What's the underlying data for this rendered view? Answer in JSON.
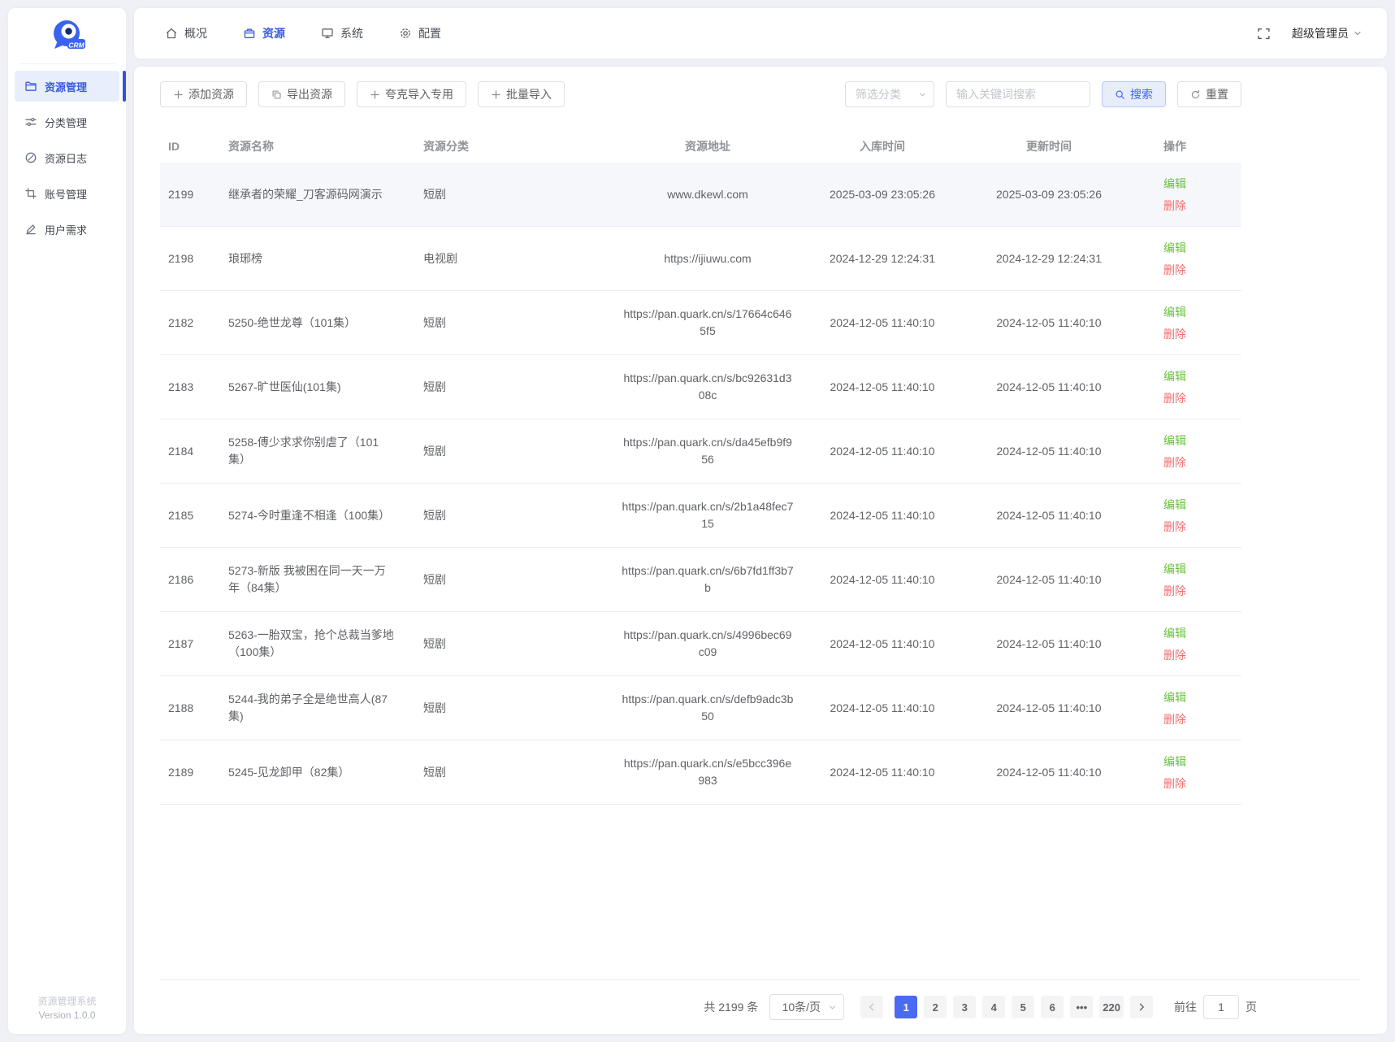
{
  "app": {
    "system_name": "资源管理系统",
    "version": "Version 1.0.0"
  },
  "topnav": {
    "items": [
      {
        "label": "概况",
        "icon": "home-icon",
        "active": false
      },
      {
        "label": "资源",
        "icon": "box-icon",
        "active": true
      },
      {
        "label": "系统",
        "icon": "monitor-icon",
        "active": false
      },
      {
        "label": "配置",
        "icon": "gear-icon",
        "active": false
      }
    ],
    "user": "超级管理员"
  },
  "sidebar": {
    "items": [
      {
        "label": "资源管理",
        "icon": "folder-icon",
        "active": true
      },
      {
        "label": "分类管理",
        "icon": "sliders-icon",
        "active": false
      },
      {
        "label": "资源日志",
        "icon": "compass-icon",
        "active": false
      },
      {
        "label": "账号管理",
        "icon": "crop-icon",
        "active": false
      },
      {
        "label": "用户需求",
        "icon": "pen-icon",
        "active": false
      }
    ]
  },
  "toolbar": {
    "add_label": "添加资源",
    "export_label": "导出资源",
    "quark_label": "夸克导入专用",
    "batch_label": "批量导入",
    "filter_placeholder": "筛选分类",
    "search_placeholder": "输入关键词搜索",
    "search_label": "搜索",
    "reset_label": "重置"
  },
  "table": {
    "columns": [
      "ID",
      "资源名称",
      "资源分类",
      "资源地址",
      "入库时间",
      "更新时间",
      "操作"
    ],
    "actions": {
      "edit": "编辑",
      "delete": "删除"
    },
    "rows": [
      {
        "id": "2199",
        "name": "继承者的荣耀_刀客源码网演示",
        "category": "短剧",
        "url": "www.dkewl.com",
        "created": "2025-03-09 23:05:26",
        "updated": "2025-03-09 23:05:26",
        "highlight": true
      },
      {
        "id": "2198",
        "name": "琅琊榜",
        "category": "电视剧",
        "url": "https://ijiuwu.com",
        "created": "2024-12-29 12:24:31",
        "updated": "2024-12-29 12:24:31",
        "highlight": false
      },
      {
        "id": "2182",
        "name": "5250-绝世龙尊（101集）",
        "category": "短剧",
        "url": "https://pan.quark.cn/s/17664c6465f5",
        "created": "2024-12-05 11:40:10",
        "updated": "2024-12-05 11:40:10",
        "highlight": false
      },
      {
        "id": "2183",
        "name": "5267-旷世医仙(101集)",
        "category": "短剧",
        "url": "https://pan.quark.cn/s/bc92631d308c",
        "created": "2024-12-05 11:40:10",
        "updated": "2024-12-05 11:40:10",
        "highlight": false
      },
      {
        "id": "2184",
        "name": "5258-傅少求求你别虐了（101集）",
        "category": "短剧",
        "url": "https://pan.quark.cn/s/da45efb9f956",
        "created": "2024-12-05 11:40:10",
        "updated": "2024-12-05 11:40:10",
        "highlight": false
      },
      {
        "id": "2185",
        "name": "5274-今时重逢不相逢（100集）",
        "category": "短剧",
        "url": "https://pan.quark.cn/s/2b1a48fec715",
        "created": "2024-12-05 11:40:10",
        "updated": "2024-12-05 11:40:10",
        "highlight": false
      },
      {
        "id": "2186",
        "name": "5273-新版 我被困在同一天一万年（84集）",
        "category": "短剧",
        "url": "https://pan.quark.cn/s/6b7fd1ff3b7b",
        "created": "2024-12-05 11:40:10",
        "updated": "2024-12-05 11:40:10",
        "highlight": false
      },
      {
        "id": "2187",
        "name": "5263-一胎双宝，抢个总裁当爹地（100集）",
        "category": "短剧",
        "url": "https://pan.quark.cn/s/4996bec69c09",
        "created": "2024-12-05 11:40:10",
        "updated": "2024-12-05 11:40:10",
        "highlight": false
      },
      {
        "id": "2188",
        "name": "5244-我的弟子全是绝世高人(87集)",
        "category": "短剧",
        "url": "https://pan.quark.cn/s/defb9adc3b50",
        "created": "2024-12-05 11:40:10",
        "updated": "2024-12-05 11:40:10",
        "highlight": false
      },
      {
        "id": "2189",
        "name": "5245-见龙卸甲（82集）",
        "category": "短剧",
        "url": "https://pan.quark.cn/s/e5bcc396e983",
        "created": "2024-12-05 11:40:10",
        "updated": "2024-12-05 11:40:10",
        "highlight": false
      }
    ]
  },
  "pagination": {
    "total_label": "共 2199 条",
    "page_size": "10条/页",
    "pages": [
      "1",
      "2",
      "3",
      "4",
      "5",
      "6",
      "•••",
      "220"
    ],
    "active_page": "1",
    "goto_label": "前往",
    "goto_value": "1",
    "goto_suffix": "页"
  },
  "colors": {
    "primary": "#3a5be0",
    "pager_active": "#4a6af2",
    "edit_green": "#67c23a",
    "delete_red": "#f56c6c",
    "row_highlight": "#f5f7fa"
  }
}
